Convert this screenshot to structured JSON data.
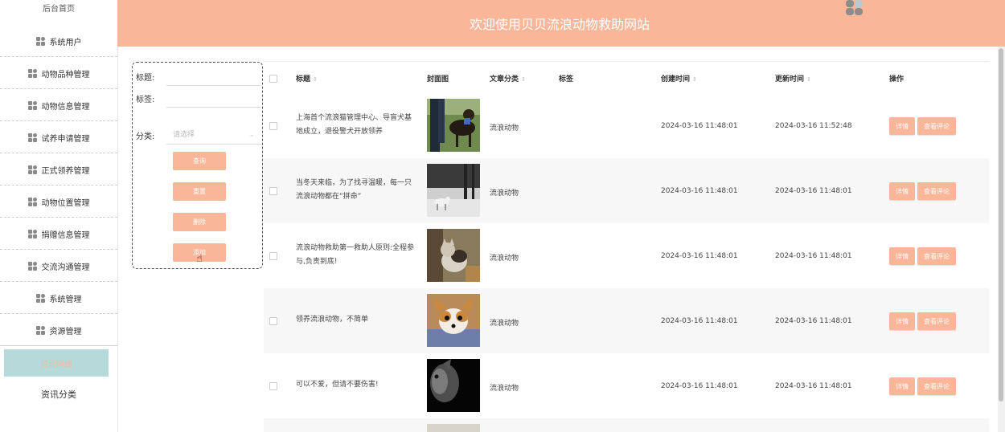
{
  "sidebar": {
    "home_label": "后台首页",
    "items": [
      {
        "label": "系统用户",
        "icon": "grid-icon"
      },
      {
        "label": "动物品种管理",
        "icon": "grid-icon"
      },
      {
        "label": "动物信息管理",
        "icon": "grid-icon"
      },
      {
        "label": "试养申请管理",
        "icon": "grid-icon"
      },
      {
        "label": "正式领养管理",
        "icon": "grid-icon"
      },
      {
        "label": "动物位置管理",
        "icon": "grid-icon"
      },
      {
        "label": "捐赠信息管理",
        "icon": "grid-icon"
      },
      {
        "label": "交流沟通管理",
        "icon": "grid-icon"
      },
      {
        "label": "系统管理",
        "icon": "grid-icon"
      },
      {
        "label": "资源管理",
        "icon": "grid-icon"
      }
    ],
    "sub_items": [
      {
        "label": "资讯网络"
      },
      {
        "label": "资讯分类"
      }
    ]
  },
  "header": {
    "title": "欢迎使用贝贝流浪动物救助网站"
  },
  "search": {
    "title_label": "标题:",
    "tag_label": "标签:",
    "category_label": "分类:",
    "category_placeholder": "请选择",
    "buttons": {
      "query": "查询",
      "reset": "重置",
      "delete": "删除",
      "add": "添加"
    }
  },
  "table": {
    "columns": [
      "标题",
      "封面图",
      "文章分类",
      "标签",
      "创建时间",
      "更新时间",
      "操作"
    ],
    "rows": [
      {
        "title": "上海首个流浪猫管理中心、导盲犬基地成立，退役警犬开放领养",
        "category": "流浪动物",
        "tag": "",
        "created": "2024-03-16 11:48:01",
        "updated": "2024-03-16 11:52:48",
        "detail": "详情",
        "comments": "查看评论"
      },
      {
        "title": "当冬天来临，为了找寻温暖，每一只流浪动物都在“拼命”",
        "category": "流浪动物",
        "tag": "",
        "created": "2024-03-16 11:48:01",
        "updated": "2024-03-16 11:48:01",
        "detail": "详情",
        "comments": "查看评论"
      },
      {
        "title": "流浪动物救助第一救助人原则:全程参与,负责到底!",
        "category": "流浪动物",
        "tag": "",
        "created": "2024-03-16 11:48:01",
        "updated": "2024-03-16 11:48:01",
        "detail": "详情",
        "comments": "查看评论"
      },
      {
        "title": "领养流浪动物，不简单",
        "category": "流浪动物",
        "tag": "",
        "created": "2024-03-16 11:48:01",
        "updated": "2024-03-16 11:48:01",
        "detail": "详情",
        "comments": "查看评论"
      },
      {
        "title": "可以不爱，但请不要伤害!",
        "category": "流浪动物",
        "tag": "",
        "created": "2024-03-16 11:48:01",
        "updated": "2024-03-16 11:48:01",
        "detail": "详情",
        "comments": "查看评论"
      }
    ]
  },
  "colors": {
    "accent": "#f9b698",
    "active_bg": "#b6d9da",
    "active_text": "#f4b9a0"
  }
}
